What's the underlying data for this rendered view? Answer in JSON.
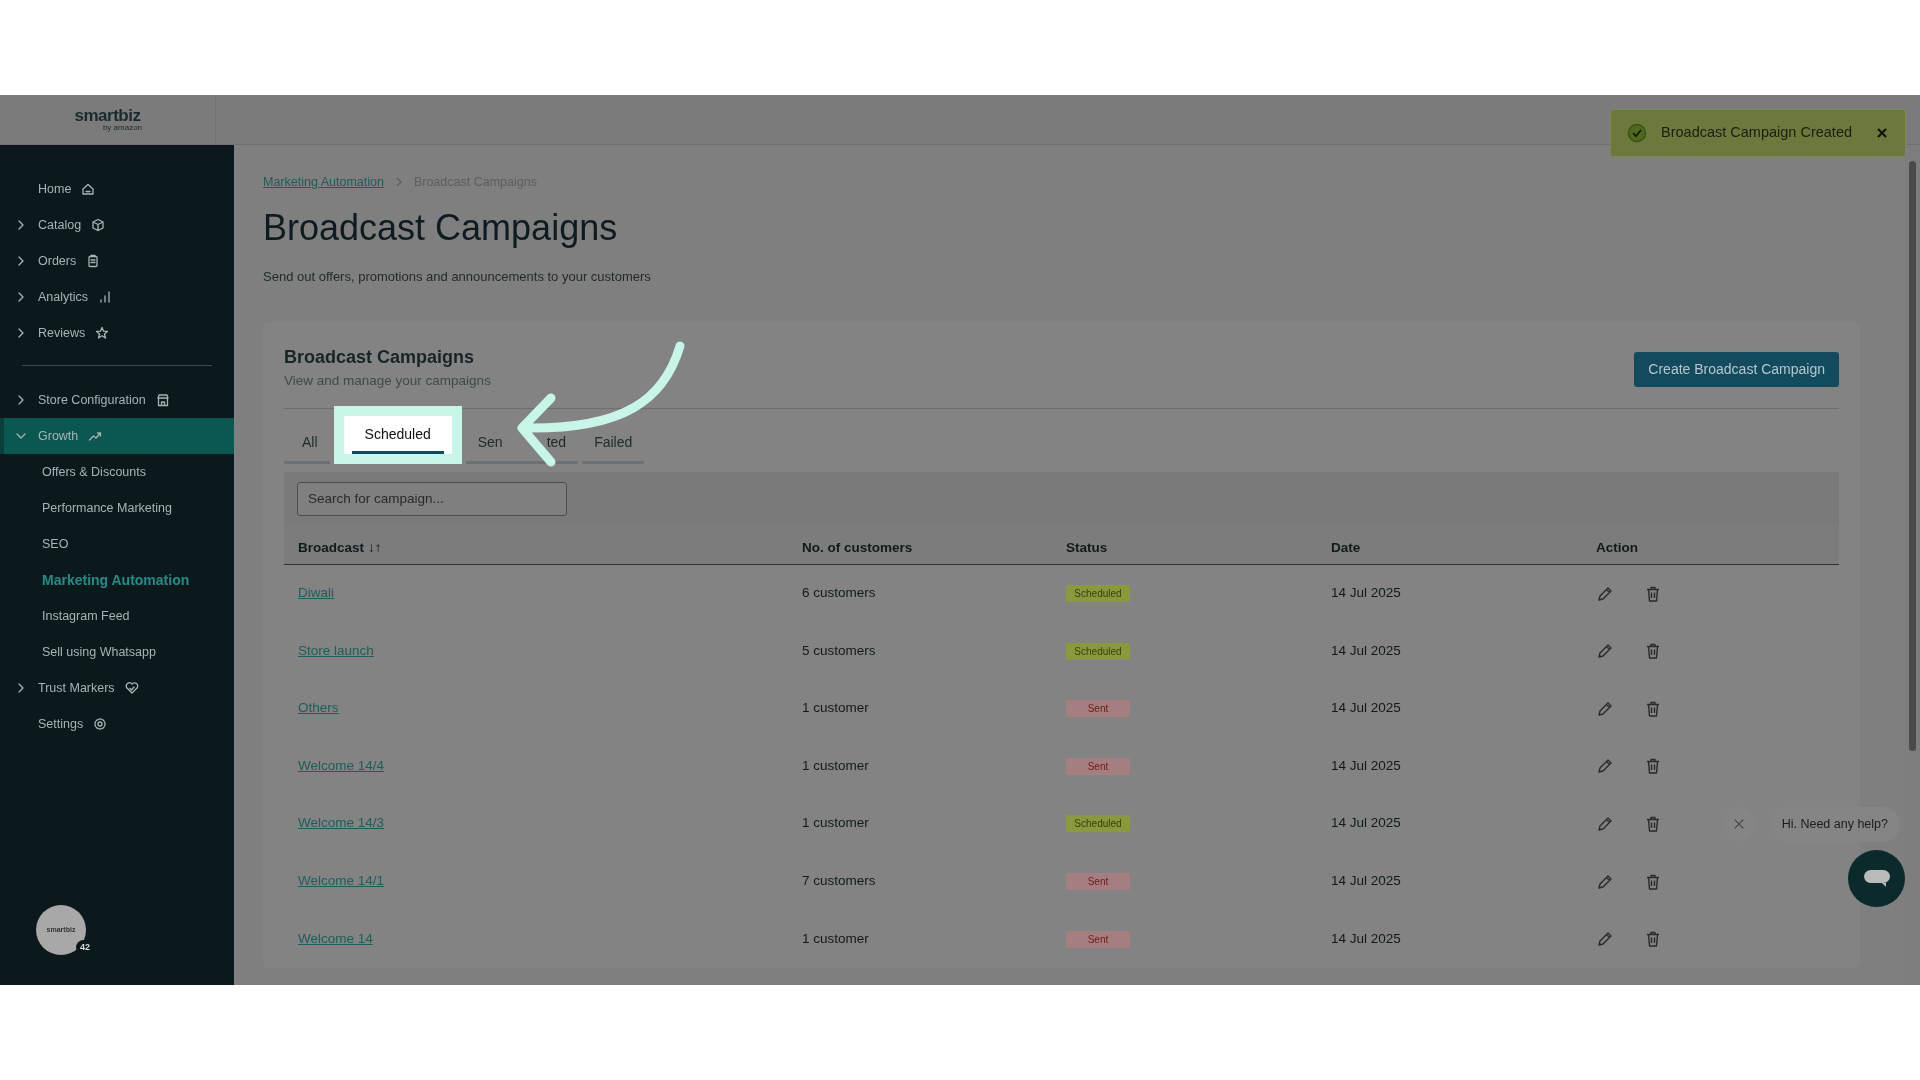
{
  "toast": {
    "message": "Broadcast Campaign Created"
  },
  "logo": {
    "name": "smartbiz",
    "tagline": "by amazon"
  },
  "sidebar": {
    "items": [
      {
        "label": "Home",
        "kind": "link",
        "selected": false
      },
      {
        "label": "Catalog",
        "kind": "group",
        "expanded": false,
        "selected": false
      },
      {
        "label": "Orders",
        "kind": "group",
        "expanded": false,
        "selected": false
      },
      {
        "label": "Analytics",
        "kind": "group",
        "expanded": false,
        "selected": false
      },
      {
        "label": "Reviews",
        "kind": "group",
        "expanded": false,
        "selected": false,
        "divider_after": true
      },
      {
        "label": "Store Configuration",
        "kind": "group",
        "expanded": false,
        "selected": false
      },
      {
        "label": "Growth",
        "kind": "group",
        "expanded": true,
        "selected": true,
        "children": [
          {
            "label": "Offers & Discounts",
            "selected": false
          },
          {
            "label": "Performance Marketing",
            "selected": false
          },
          {
            "label": "SEO",
            "selected": false
          },
          {
            "label": "Marketing Automation",
            "selected": true
          },
          {
            "label": "Instagram Feed",
            "selected": false
          },
          {
            "label": "Sell using Whatsapp",
            "selected": false
          }
        ]
      },
      {
        "label": "Trust Markers",
        "kind": "group",
        "expanded": false,
        "selected": false
      },
      {
        "label": "Settings",
        "kind": "link",
        "selected": false
      }
    ],
    "avatar": {
      "badge": "42",
      "logo": "smartbiz"
    }
  },
  "breadcrumb": [
    {
      "label": "Marketing Automation",
      "link": true
    },
    {
      "label": "Broadcast Campaigns",
      "link": false
    }
  ],
  "page": {
    "title": "Broadcast Campaigns",
    "subtitle": "Send out offers, promotions and announcements to your customers"
  },
  "card": {
    "title": "Broadcast Campaigns",
    "subtitle": "View and manage your campaigns",
    "button": "Create Broadcast Campaign"
  },
  "tabs": [
    {
      "parts": [
        "All"
      ],
      "selected": false,
      "highlighted": false
    },
    {
      "parts": [
        "Scheduled"
      ],
      "selected": true,
      "highlighted": true
    },
    {
      "parts": [
        "Sen",
        "ted"
      ],
      "selected": false,
      "highlighted": false
    },
    {
      "parts": [
        "Failed"
      ],
      "selected": false,
      "highlighted": false
    }
  ],
  "search": {
    "placeholder": "Search for campaign..."
  },
  "table": {
    "columns": [
      "Broadcast",
      "No. of customers",
      "Status",
      "Date",
      "Action"
    ],
    "sort_icon": "↓↑",
    "rows": [
      {
        "name": "Diwali",
        "customers": "6 customers",
        "status": "Scheduled",
        "kind": "scheduled",
        "date": "14 Jul 2025"
      },
      {
        "name": "Store launch",
        "customers": "5 customers",
        "status": "Scheduled",
        "kind": "scheduled",
        "date": "14 Jul 2025"
      },
      {
        "name": "Others",
        "customers": "1 customer",
        "status": "Sent",
        "kind": "sent",
        "date": "14 Jul 2025"
      },
      {
        "name": "Welcome 14/4",
        "customers": "1 customer",
        "status": "Sent",
        "kind": "sent",
        "date": "14 Jul 2025"
      },
      {
        "name": "Welcome 14/3",
        "customers": "1 customer",
        "status": "Scheduled",
        "kind": "scheduled",
        "date": "14 Jul 2025"
      },
      {
        "name": "Welcome 14/1",
        "customers": "7 customers",
        "status": "Sent",
        "kind": "sent",
        "date": "14 Jul 2025"
      },
      {
        "name": "Welcome 14",
        "customers": "1 customer",
        "status": "Sent",
        "kind": "sent",
        "date": "14 Jul 2025"
      }
    ]
  },
  "chat": {
    "prompt": "Hi. Need any help?"
  }
}
